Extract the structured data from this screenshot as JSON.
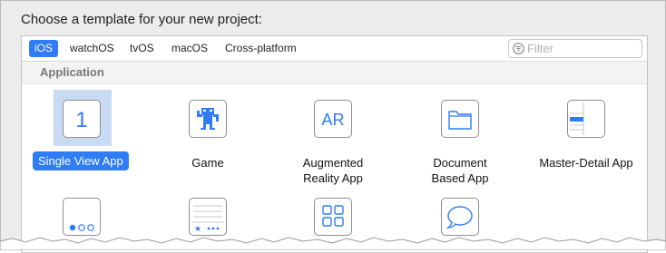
{
  "heading": "Choose a template for your new project:",
  "tabs": [
    {
      "label": "iOS",
      "active": true
    },
    {
      "label": "watchOS",
      "active": false
    },
    {
      "label": "tvOS",
      "active": false
    },
    {
      "label": "macOS",
      "active": false
    },
    {
      "label": "Cross-platform",
      "active": false
    }
  ],
  "filter": {
    "placeholder": "Filter",
    "value": ""
  },
  "section_title": "Application",
  "templates": [
    {
      "label": "Single View App",
      "icon": "single-view-icon",
      "glyph": "1",
      "selected": true
    },
    {
      "label": "Game",
      "icon": "game-icon",
      "selected": false
    },
    {
      "label": "Augmented\nReality App",
      "icon": "ar-icon",
      "glyph": "AR",
      "selected": false
    },
    {
      "label": "Document\nBased App",
      "icon": "folder-icon",
      "selected": false
    },
    {
      "label": "Master-Detail App",
      "icon": "master-detail-icon",
      "selected": false
    },
    {
      "label": "",
      "icon": "page-based-icon",
      "selected": false
    },
    {
      "label": "",
      "icon": "tabbed-app-icon",
      "selected": false
    },
    {
      "label": "",
      "icon": "sticker-pack-icon",
      "selected": false
    },
    {
      "label": "",
      "icon": "imessage-icon",
      "selected": false
    }
  ],
  "colors": {
    "accent": "#2f7cf6",
    "selection_bg": "#c9daf5"
  }
}
